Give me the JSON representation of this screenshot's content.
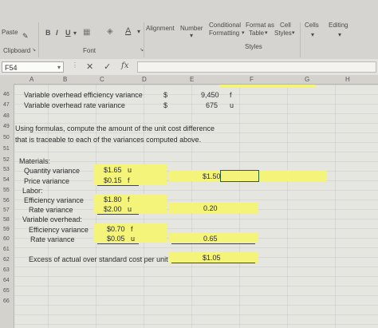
{
  "ribbon": {
    "paste": "Paste",
    "bold": "B",
    "italic": "I",
    "underline": "U",
    "font_color": "A",
    "alignment": "Alignment",
    "number": "Number",
    "conditional_formatting": "Conditional Formatting",
    "conditional_line1": "Conditional",
    "conditional_line2": "Formatting",
    "format_as_table_line1": "Format as",
    "format_as_table_line2": "Table",
    "cell_styles_line1": "Cell",
    "cell_styles_line2": "Styles",
    "cells": "Cells",
    "editing": "Editing",
    "clipboard": "Clipboard",
    "font": "Font",
    "styles": "Styles"
  },
  "formula_bar": {
    "name_box": "F54",
    "cancel": "✕",
    "enter": "✓",
    "fx": "fx",
    "content": ""
  },
  "columns": [
    "A",
    "B",
    "C",
    "D",
    "E",
    "F",
    "G",
    "H"
  ],
  "rows": {
    "r46": {
      "num": "46",
      "b": "Variable overhead efficiency variance",
      "d": "$",
      "e": "9,450",
      "e_tag": "f"
    },
    "r47": {
      "num": "47",
      "b": "Variable overhead rate variance",
      "d": "$",
      "e": "675",
      "e_tag": "u"
    },
    "r48": {
      "num": "48"
    },
    "r49": {
      "num": "49",
      "a": "Using formulas, compute the amount of the unit cost difference"
    },
    "r50": {
      "num": "50",
      "a": "that is traceable to each of the variances computed above."
    },
    "r51": {
      "num": "51"
    },
    "r52": {
      "num": "52",
      "a": "Materials:"
    },
    "r53": {
      "num": "53",
      "a": "Quantity variance",
      "c": "$1.65",
      "c_tag": "u"
    },
    "r54": {
      "num": "54",
      "a": "Price variance",
      "c": "$0.15",
      "c_tag": "f",
      "e": "$1.50"
    },
    "r55": {
      "num": "55",
      "a": "Labor:"
    },
    "r56": {
      "num": "56",
      "a": "Efficiency variance",
      "c": "$1.80",
      "c_tag": "f"
    },
    "r57": {
      "num": "57",
      "a": "Rate variance",
      "c": "$2.00",
      "c_tag": "u",
      "e": "0.20"
    },
    "r58": {
      "num": "58",
      "a": "Variable overhead:"
    },
    "r59": {
      "num": "59",
      "a": "Efficiency variance",
      "c": "$0.70",
      "c_tag": "f"
    },
    "r60": {
      "num": "60",
      "a": "Rate variance",
      "c": "$0.05",
      "c_tag": "u",
      "e": "0.65"
    },
    "r61": {
      "num": "61"
    },
    "r62": {
      "num": "62",
      "a": "Excess of actual over standard cost per unit",
      "e": "$1.05"
    },
    "r63": {
      "num": "63"
    },
    "r64": {
      "num": "64"
    },
    "r65": {
      "num": "65"
    },
    "r66": {
      "num": "66"
    }
  },
  "colors": {
    "highlight": "#f4f37a",
    "selection": "#2f5f3a"
  }
}
